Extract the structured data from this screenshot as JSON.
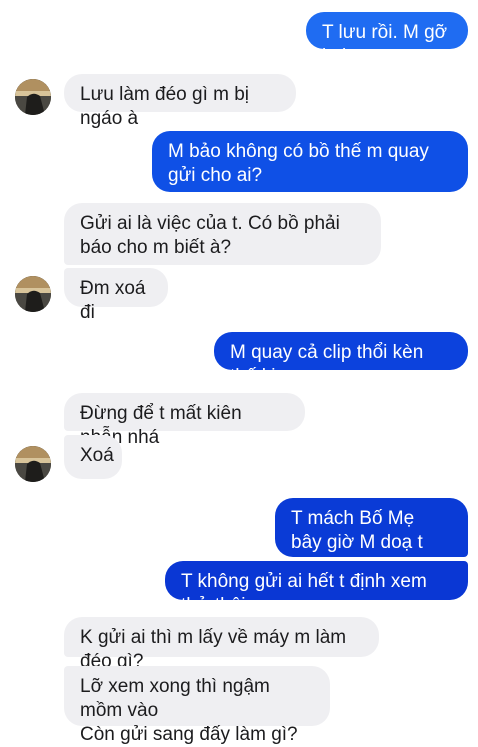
{
  "colors": {
    "outgoing_bubble_light": "#1f6cf2",
    "outgoing_bubble_dark": "#0a37d4",
    "incoming_bubble": "#efeff2",
    "incoming_text": "#1c1c1e",
    "outgoing_text": "#ffffff"
  },
  "messages": [
    {
      "direction": "outgoing",
      "text": "T lưu rồi. M gỡ lmj"
    },
    {
      "direction": "incoming",
      "text": "Lưu làm đéo gì m bị ngáo à"
    },
    {
      "direction": "outgoing",
      "text": "M bảo không có bồ thế m quay gửi cho ai?"
    },
    {
      "direction": "incoming",
      "text": "Gửi ai là việc của t. Có bồ phải báo cho m biết à?"
    },
    {
      "direction": "incoming",
      "text": "Đm xoá đi"
    },
    {
      "direction": "outgoing",
      "text": "M quay cả clip thổi kèn thế kia"
    },
    {
      "direction": "incoming",
      "text": "Đừng để t mất kiên nhẫn nhá"
    },
    {
      "direction": "incoming",
      "text": "Xoá"
    },
    {
      "direction": "outgoing",
      "text": "T mách Bố Mẹ bây giờ M doạ t đấy à"
    },
    {
      "direction": "outgoing",
      "text": "T không gửi ai hết t định xem thử thôi"
    },
    {
      "direction": "incoming",
      "text": "K gửi ai thì m lấy về máy m làm đéo gì?"
    },
    {
      "direction": "incoming",
      "text": "Lỡ xem xong thì ngậm mồm vào\nCòn gửi sang đấy làm gì?"
    }
  ]
}
